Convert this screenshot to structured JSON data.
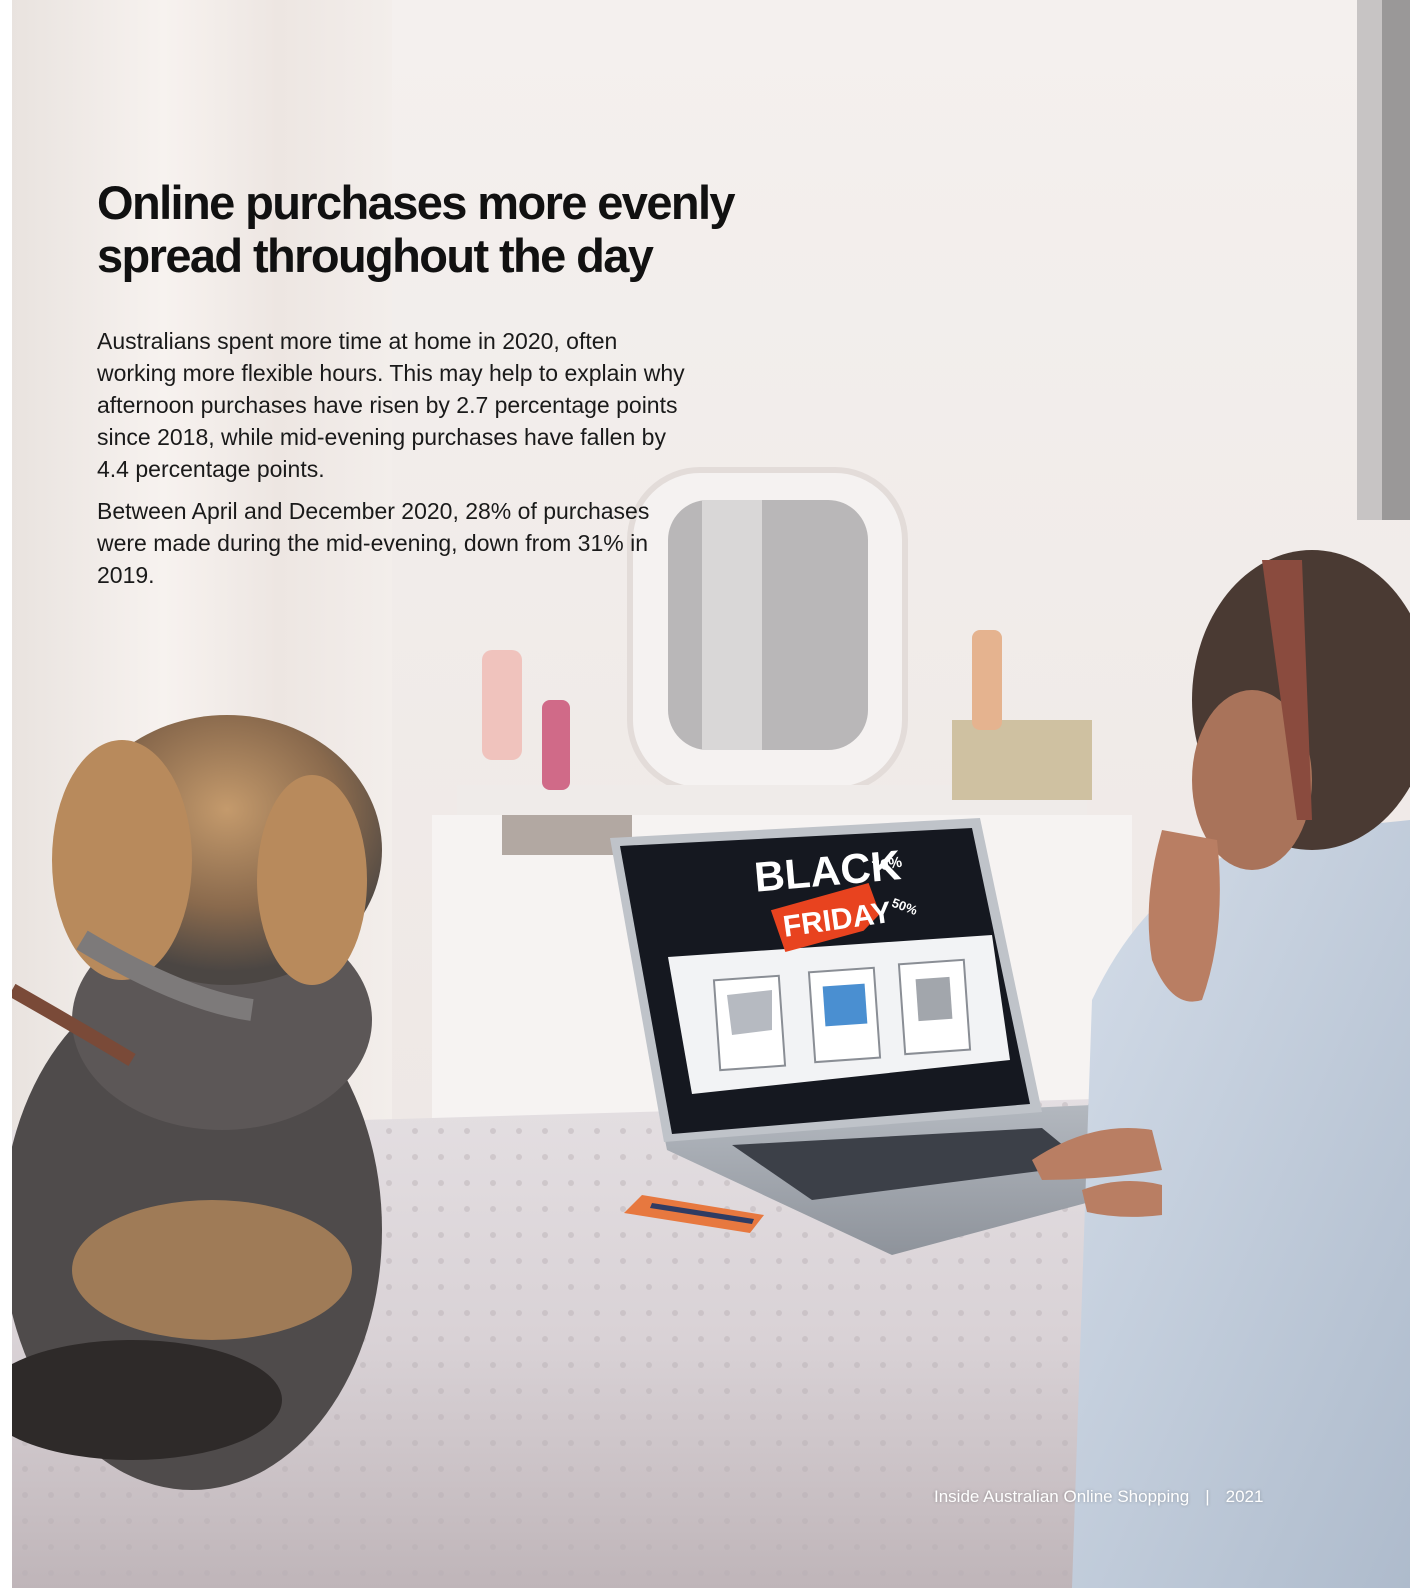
{
  "article": {
    "headline": "Online purchases more evenly spread throughout the day",
    "paragraphs": [
      "Australians spent more time at home in 2020, often working more flexible hours. This may help to explain why afternoon purchases have risen by 2.7 percentage points since 2018, while mid-evening purchases have fallen by 4.4 percentage points.",
      "Between April and December 2020, 28% of purchases were made during the mid-evening, down from 31% in 2019."
    ]
  },
  "footer": {
    "publication": "Inside Australian Online Shopping",
    "separator": "|",
    "year": "2021"
  },
  "photo": {
    "screen_text_1": "BLACK",
    "screen_text_2": "FRIDAY",
    "discount_1": "70%",
    "discount_2": "50%"
  },
  "colors": {
    "friday_tag": "#e8431f",
    "wall": "#f3eeeb",
    "shirt": "#c9d4e2"
  }
}
